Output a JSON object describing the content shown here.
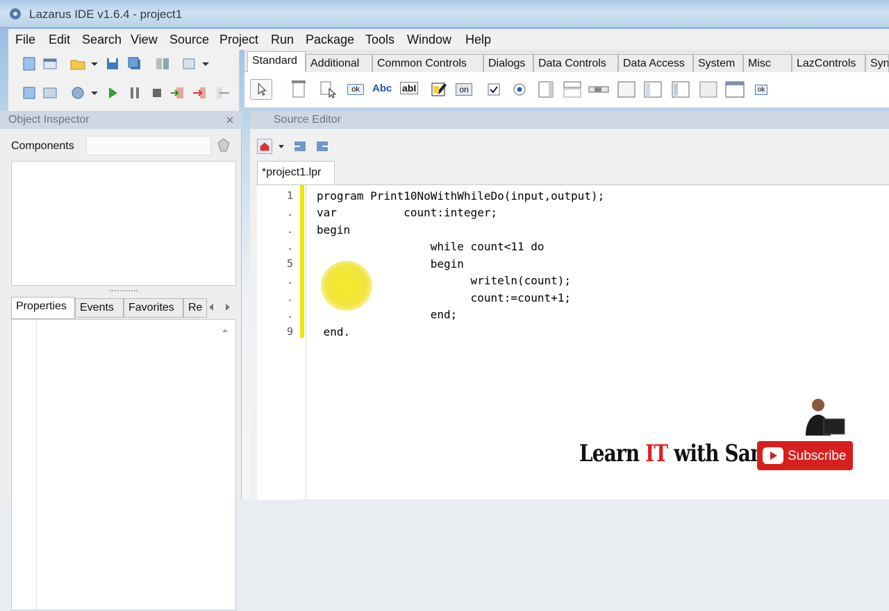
{
  "window": {
    "title": "Lazarus IDE v1.6.4 - project1"
  },
  "menu": [
    "File",
    "Edit",
    "Search",
    "View",
    "Source",
    "Project",
    "Run",
    "Package",
    "Tools",
    "Window",
    "Help"
  ],
  "palette": {
    "tabs": [
      "Standard",
      "Additional",
      "Common Controls",
      "Dialogs",
      "Data Controls",
      "Data Access",
      "System",
      "Misc",
      "LazControls",
      "Syn"
    ],
    "active_tab": "Standard",
    "components": [
      {
        "icon": "pointer-icon",
        "text": ""
      },
      {
        "icon": "main-menu-icon",
        "text": ""
      },
      {
        "icon": "popup-menu-icon",
        "text": ""
      },
      {
        "icon": "button-icon",
        "text": "ok"
      },
      {
        "icon": "label-icon",
        "text": "Abc"
      },
      {
        "icon": "edit-icon",
        "text": "abI"
      },
      {
        "icon": "memo-icon",
        "text": ""
      },
      {
        "icon": "togglebox-icon",
        "text": "on"
      },
      {
        "icon": "checkbox-icon",
        "text": ""
      },
      {
        "icon": "radiobutton-icon",
        "text": ""
      },
      {
        "icon": "listbox-icon",
        "text": ""
      },
      {
        "icon": "combobox-icon",
        "text": ""
      },
      {
        "icon": "scrollbar-icon",
        "text": ""
      },
      {
        "icon": "groupbox-icon",
        "text": ""
      },
      {
        "icon": "radiogroup-icon",
        "text": ""
      },
      {
        "icon": "checkgroup-icon",
        "text": ""
      },
      {
        "icon": "panel-icon",
        "text": ""
      },
      {
        "icon": "frame-icon",
        "text": ""
      },
      {
        "icon": "actionlist-icon",
        "text": "ok"
      }
    ]
  },
  "object_inspector": {
    "title": "Object Inspector",
    "components_label": "Components",
    "tabs": [
      "Properties",
      "Events",
      "Favorites",
      "Re"
    ],
    "active_tab": "Properties"
  },
  "source_editor": {
    "title": "Source Editor",
    "file_tab": "*project1.lpr",
    "gutter": [
      "1",
      ".",
      ".",
      ".",
      "5",
      ".",
      ".",
      ".",
      "9"
    ],
    "lines": [
      "program Print10NoWithWhileDo(input,output);",
      "var          count:integer;",
      "begin",
      "                 while count<11 do",
      "                 begin",
      "                       writeln(count);",
      "                       count:=count+1;",
      "                 end;",
      " end."
    ]
  },
  "branding": {
    "pre": "Learn ",
    "it": "IT",
    "post": " with Samitha",
    "subscribe": "Subscribe"
  },
  "colors": {
    "accent_red": "#d7201e",
    "modified_bar": "#f2e200",
    "highlight_spot": "#f2e43e"
  }
}
